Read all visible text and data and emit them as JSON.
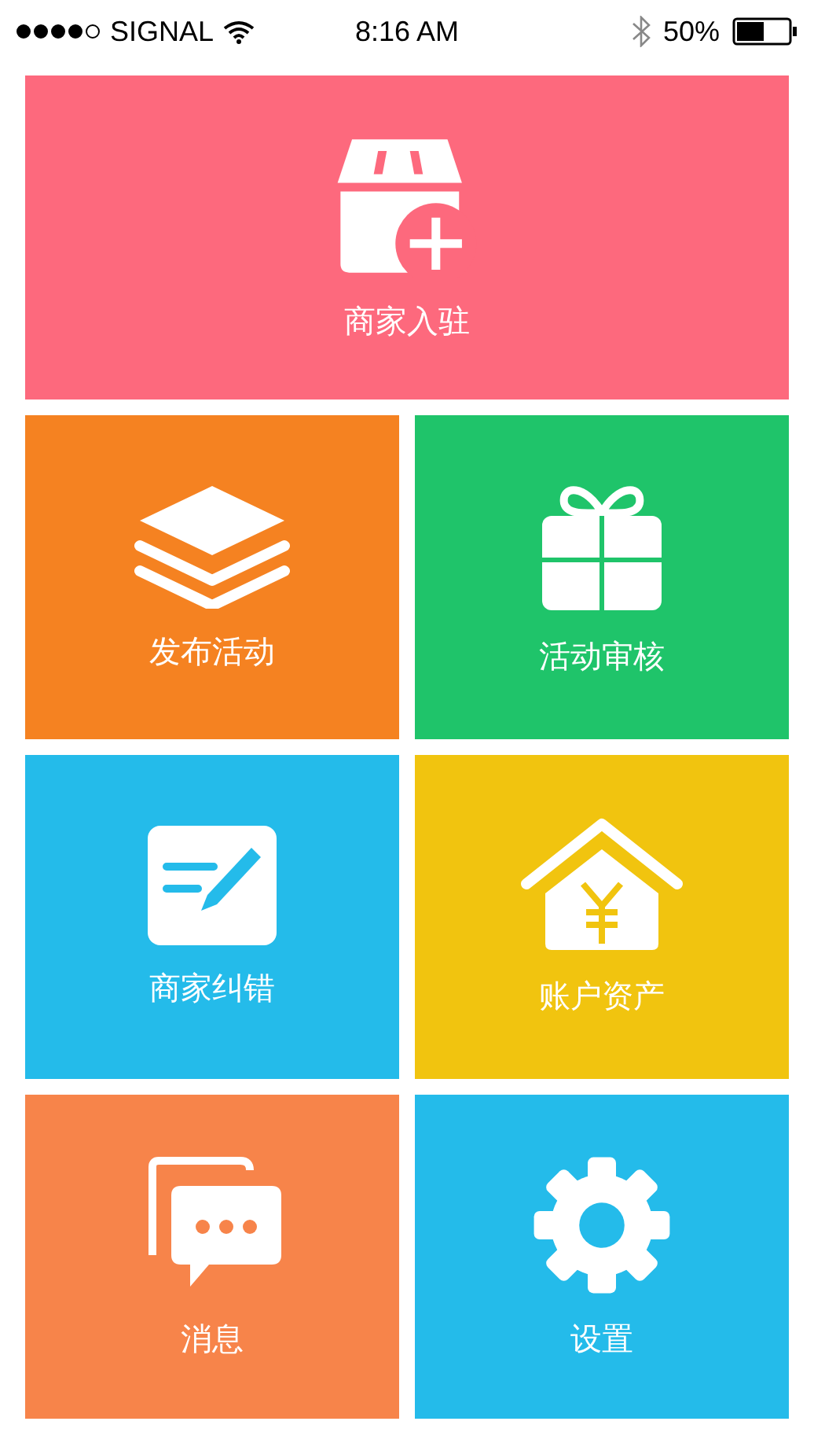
{
  "status_bar": {
    "carrier": "SIGNAL",
    "time": "8:16 AM",
    "battery": "50%"
  },
  "tiles": [
    {
      "label": "商家入驻",
      "kind": "store",
      "color": "#fd697d",
      "wide": true
    },
    {
      "label": "发布活动",
      "kind": "layers",
      "color": "#f58221",
      "wide": false
    },
    {
      "label": "活动审核",
      "kind": "gift",
      "color": "#1fc46a",
      "wide": false
    },
    {
      "label": "商家纠错",
      "kind": "edit",
      "color": "#24bbea",
      "wide": false
    },
    {
      "label": "账户资产",
      "kind": "house",
      "color": "#f1c40f",
      "wide": false
    },
    {
      "label": "消息",
      "kind": "chat",
      "color": "#f7844a",
      "wide": false
    },
    {
      "label": "设置",
      "kind": "gear",
      "color": "#24bbea",
      "wide": false
    }
  ]
}
